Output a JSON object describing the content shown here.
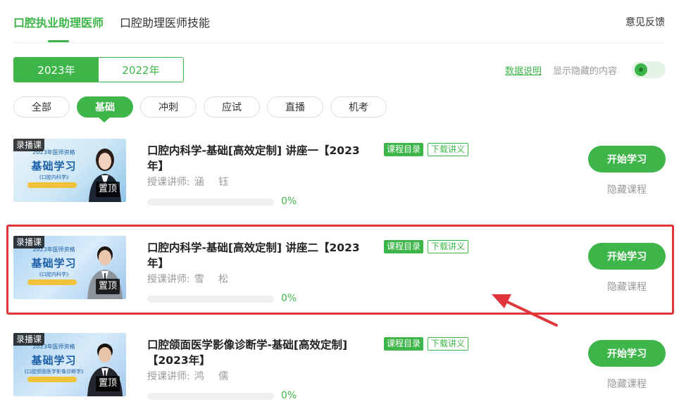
{
  "top_tabs": {
    "tab1": "口腔执业助理医师",
    "tab2": "口腔助理医师技能",
    "feedback": "意见反馈"
  },
  "years": {
    "active": "2023年",
    "other": "2022年"
  },
  "options": {
    "data_note": "数据说明",
    "show_hidden": "显示隐藏的内容",
    "show_hidden_enabled": true
  },
  "categories": [
    "全部",
    "基础",
    "冲刺",
    "应试",
    "直播",
    "机考"
  ],
  "active_category": "基础",
  "theme": {
    "accent": "#3eb549",
    "highlight": "#e0363b"
  },
  "courses": [
    {
      "tag": "录播课",
      "pin": "置顶",
      "thumb_sub": "2023年医师资格",
      "thumb_big": "基础学习",
      "thumb_course": "《口腔内科学》",
      "title": "口腔内科学-基础[高效定制] 讲座一【2023年】",
      "catalog": "课程目录",
      "download": "下载讲义",
      "teacher_label": "授课讲师:",
      "teacher": "涵 钰",
      "progress_pct": 0,
      "progress_text": "0%",
      "start": "开始学习",
      "hide": "隐藏课程"
    },
    {
      "tag": "录播课",
      "pin": "置顶",
      "thumb_sub": "2023年医师资格",
      "thumb_big": "基础学习",
      "thumb_course": "《口腔内科学》",
      "title": "口腔内科学-基础[高效定制] 讲座二【2023年】",
      "catalog": "课程目录",
      "download": "下载讲义",
      "teacher_label": "授课讲师:",
      "teacher": "雪 松",
      "progress_pct": 0,
      "progress_text": "0%",
      "start": "开始学习",
      "hide": "隐藏课程"
    },
    {
      "tag": "录播课",
      "pin": "置顶",
      "thumb_sub": "2023年医师资格",
      "thumb_big": "基础学习",
      "thumb_course": "《口腔颌面医学影像诊断学》",
      "title": "口腔颌面医学影像诊断学-基础[高效定制]【2023年】",
      "catalog": "课程目录",
      "download": "下载讲义",
      "teacher_label": "授课讲师:",
      "teacher": "鸿 儒",
      "progress_pct": 0,
      "progress_text": "0%",
      "start": "开始学习",
      "hide": "隐藏课程"
    }
  ]
}
